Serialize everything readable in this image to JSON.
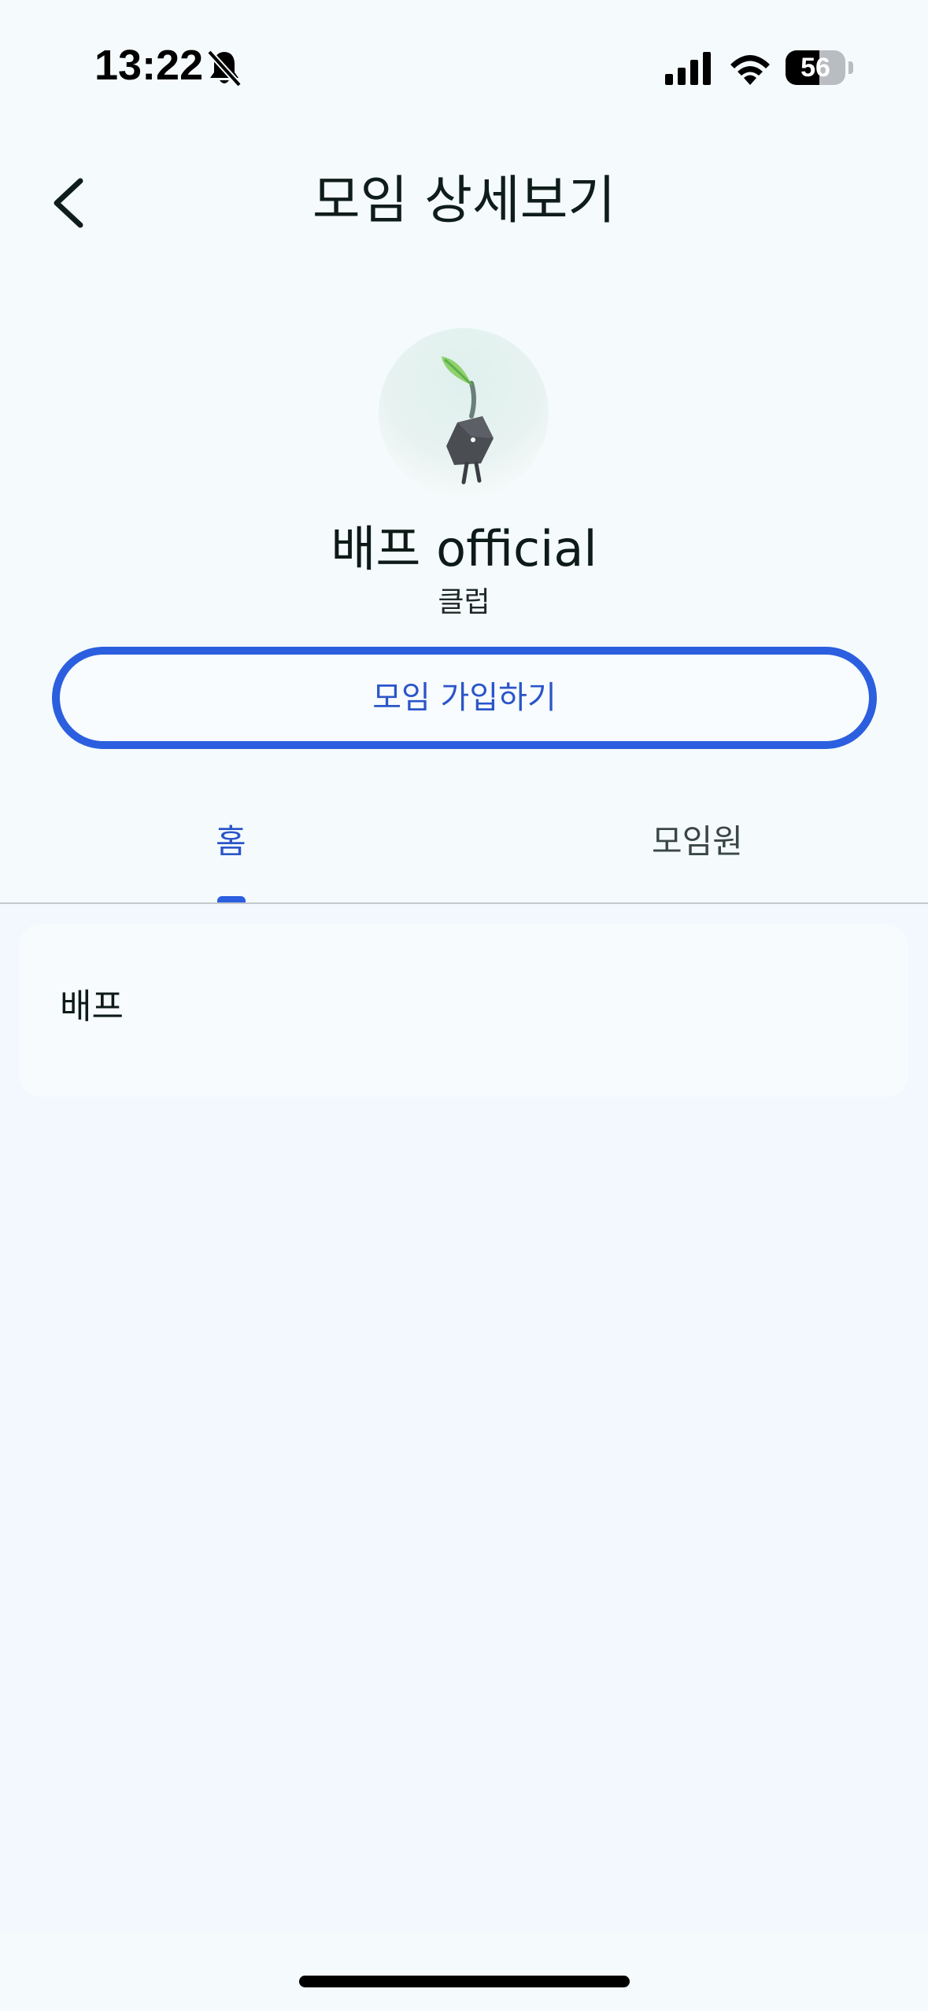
{
  "status_bar": {
    "time": "13:22",
    "battery_level": "56",
    "battery_fraction": 0.56
  },
  "header": {
    "title": "모임 상세보기"
  },
  "profile": {
    "name": "배프 official",
    "type": "클럽"
  },
  "join_button": {
    "label": "모임 가입하기"
  },
  "tabs": [
    {
      "label": "홈",
      "active": true
    },
    {
      "label": "모임원",
      "active": false
    }
  ],
  "content": {
    "intro_text": "배프"
  },
  "colors": {
    "accent": "#2c5fdf",
    "background": "#f3f7fe",
    "header_background": "#f5fbfd"
  }
}
